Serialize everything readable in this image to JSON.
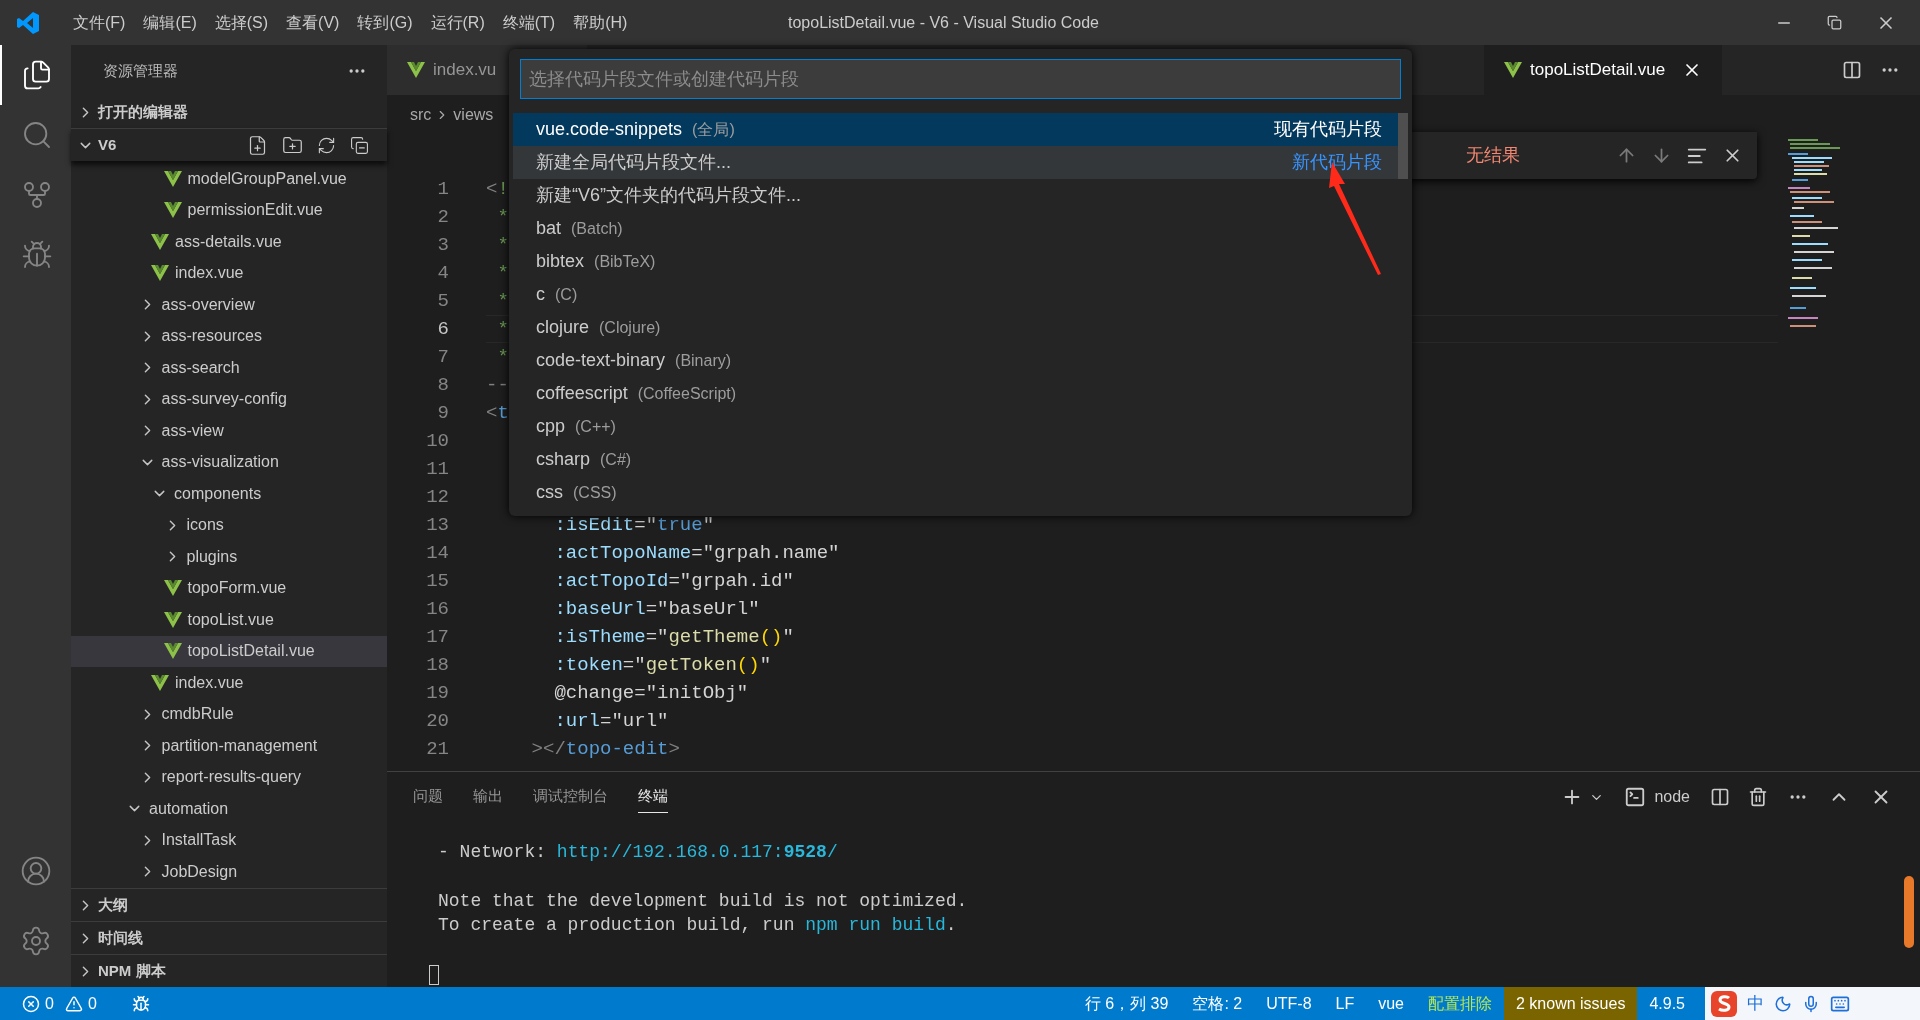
{
  "title_bar": {
    "menus": [
      "文件(F)",
      "编辑(E)",
      "选择(S)",
      "查看(V)",
      "转到(G)",
      "运行(R)",
      "终端(T)",
      "帮助(H)"
    ],
    "title": "topoListDetail.vue - V6 - Visual Studio Code"
  },
  "activity_bar": [
    {
      "kind": "files",
      "selected": true
    },
    {
      "kind": "search",
      "selected": false
    },
    {
      "kind": "scm",
      "selected": false
    },
    {
      "kind": "debug",
      "selected": false
    }
  ],
  "sidebar": {
    "title": "资源管理器",
    "open_editors": {
      "label": "打开的编辑器",
      "expanded": false
    },
    "folder": {
      "label": "V6",
      "expanded": true,
      "tree": [
        {
          "children": [
            {
              "children": [
                {
                  "children": [
                    {
                      "label": "modelGroupPanel.vue",
                      "kind": "file",
                      "selected": false
                    },
                    {
                      "label": "permissionEdit.vue",
                      "kind": "file",
                      "selected": false
                    }
                  ]
                },
                {
                  "label": "ass-details.vue",
                  "kind": "file",
                  "selected": false
                },
                {
                  "label": "index.vue",
                  "kind": "file",
                  "selected": false
                }
              ]
            },
            {
              "label": "ass-overview",
              "kind": "folder",
              "expanded": false,
              "selected": false
            },
            {
              "label": "ass-resources",
              "kind": "folder",
              "expanded": false,
              "selected": false
            },
            {
              "label": "ass-search",
              "kind": "folder",
              "expanded": false,
              "selected": false
            },
            {
              "label": "ass-survey-config",
              "kind": "folder",
              "expanded": false,
              "selected": false
            },
            {
              "label": "ass-view",
              "kind": "folder",
              "expanded": false,
              "selected": false
            },
            {
              "label": "ass-visualization",
              "kind": "folder",
              "expanded": true,
              "selected": false,
              "children": [
                {
                  "label": "components",
                  "kind": "folder",
                  "expanded": true,
                  "selected": false,
                  "children": [
                    {
                      "label": "icons",
                      "kind": "folder",
                      "expanded": false,
                      "selected": false
                    },
                    {
                      "label": "plugins",
                      "kind": "folder",
                      "expanded": false,
                      "selected": false
                    },
                    {
                      "label": "topoForm.vue",
                      "kind": "file",
                      "selected": false
                    },
                    {
                      "label": "topoList.vue",
                      "kind": "file",
                      "selected": false
                    },
                    {
                      "label": "topoListDetail.vue",
                      "kind": "file",
                      "selected": true
                    }
                  ]
                },
                {
                  "label": "index.vue",
                  "kind": "file",
                  "selected": false
                }
              ]
            },
            {
              "label": "cmdbRule",
              "kind": "folder",
              "expanded": false,
              "selected": false
            },
            {
              "label": "partition-management",
              "kind": "folder",
              "expanded": false,
              "selected": false
            },
            {
              "label": "report-results-query",
              "kind": "folder",
              "expanded": false,
              "selected": false
            }
          ]
        },
        {
          "label": "automation",
          "kind": "folder",
          "expanded": true,
          "selected": false,
          "children": [
            {
              "label": "InstallTask",
              "kind": "folder",
              "expanded": false,
              "selected": false
            },
            {
              "label": "JobDesign",
              "kind": "folder",
              "expanded": false,
              "selected": false
            }
          ]
        }
      ]
    },
    "sections": [
      {
        "label": "大纲",
        "expanded": false
      },
      {
        "label": "时间线",
        "expanded": false
      },
      {
        "label": "NPM 脚本",
        "expanded": false
      }
    ]
  },
  "editor": {
    "tabs": [
      {
        "label": "index.vu",
        "selected": false
      },
      {
        "label": "topoListDetail.vue",
        "selected": true
      }
    ],
    "breadcrumb": [
      "src",
      "views"
    ],
    "lines": [
      {
        "number": "1",
        "current": false,
        "tokens": [
          {
            "text": "<",
            "kind": "tag"
          },
          {
            "text": "!",
            "kind": "comment"
          }
        ]
      },
      {
        "number": "2",
        "current": false,
        "tokens": [
          {
            "text": " *",
            "kind": "comment"
          }
        ]
      },
      {
        "number": "3",
        "current": false,
        "tokens": [
          {
            "text": " *",
            "kind": "comment"
          }
        ]
      },
      {
        "number": "4",
        "current": false,
        "tokens": [
          {
            "text": " *",
            "kind": "comment"
          }
        ]
      },
      {
        "number": "5",
        "current": false,
        "tokens": [
          {
            "text": " *",
            "kind": "comment"
          }
        ]
      },
      {
        "number": "6",
        "current": true,
        "tokens": [
          {
            "text": " *",
            "kind": "comment"
          }
        ]
      },
      {
        "number": "7",
        "current": false,
        "tokens": [
          {
            "text": " *",
            "kind": "comment"
          }
        ]
      },
      {
        "number": "8",
        "current": false,
        "tokens": [
          {
            "text": "--",
            "kind": "tag"
          }
        ]
      },
      {
        "number": "9",
        "current": false,
        "tokens": [
          {
            "text": "<",
            "kind": "tag"
          },
          {
            "text": "t",
            "kind": "tagname"
          }
        ]
      },
      {
        "number": "10",
        "current": false
      },
      {
        "number": "11",
        "current": false
      },
      {
        "number": "12",
        "current": false
      },
      {
        "number": "13",
        "current": false,
        "tokens": [
          {
            "text": "      :isEdit",
            "kind": "attr"
          },
          {
            "text": "=\"",
            "kind": "text"
          },
          {
            "text": "true",
            "kind": "keyword"
          },
          {
            "text": "\"",
            "kind": "text"
          }
        ]
      },
      {
        "number": "14",
        "current": false,
        "tokens": [
          {
            "text": "      :actTopoName",
            "kind": "attr"
          },
          {
            "text": "=\"grpah.name\"",
            "kind": "text"
          }
        ]
      },
      {
        "number": "15",
        "current": false,
        "tokens": [
          {
            "text": "      :actTopoId",
            "kind": "attr"
          },
          {
            "text": "=\"grpah.id\"",
            "kind": "text"
          }
        ]
      },
      {
        "number": "16",
        "current": false,
        "tokens": [
          {
            "text": "      :baseUrl",
            "kind": "attr"
          },
          {
            "text": "=\"baseUrl\"",
            "kind": "text"
          }
        ]
      },
      {
        "number": "17",
        "current": false,
        "tokens": [
          {
            "text": "      :isTheme",
            "kind": "attr"
          },
          {
            "text": "=\"",
            "kind": "text"
          },
          {
            "text": "getTheme",
            "kind": "fn"
          },
          {
            "text": "()",
            "kind": "paren"
          },
          {
            "text": "\"",
            "kind": "text"
          }
        ]
      },
      {
        "number": "18",
        "current": false,
        "tokens": [
          {
            "text": "      :token",
            "kind": "attr"
          },
          {
            "text": "=\"",
            "kind": "text"
          },
          {
            "text": "getToken",
            "kind": "fn"
          },
          {
            "text": "()",
            "kind": "paren"
          },
          {
            "text": "\"",
            "kind": "text"
          }
        ]
      },
      {
        "number": "19",
        "current": false,
        "tokens": [
          {
            "text": "      @change=\"initObj\"",
            "kind": "text"
          }
        ]
      },
      {
        "number": "20",
        "current": false,
        "tokens": [
          {
            "text": "      :url",
            "kind": "attr"
          },
          {
            "text": "=\"url\"",
            "kind": "text"
          }
        ]
      },
      {
        "number": "21",
        "current": false,
        "tokens": [
          {
            "text": "    ></",
            "kind": "tag"
          },
          {
            "text": "topo-edit",
            "kind": "tagname"
          },
          {
            "text": ">",
            "kind": "tag"
          }
        ]
      }
    ],
    "find_widget": {
      "message": "无结果"
    }
  },
  "quick_pick": {
    "placeholder": "选择代码片段文件或创建代码片段",
    "items": [
      {
        "label": "vue.code-snippets",
        "description": "(全局)",
        "group_label": "现有代码片段",
        "selected": true,
        "hovered": false
      },
      {
        "label": "新建全局代码片段文件...",
        "group_label": "新代码片段",
        "selected": false,
        "hovered": true
      },
      {
        "label": "新建“V6”文件夹的代码片段文件...",
        "selected": false,
        "hovered": false
      },
      {
        "label": "bat",
        "description": "(Batch)",
        "selected": false,
        "hovered": false
      },
      {
        "label": "bibtex",
        "description": "(BibTeX)",
        "selected": false,
        "hovered": false
      },
      {
        "label": "c",
        "description": "(C)",
        "selected": false,
        "hovered": false
      },
      {
        "label": "clojure",
        "description": "(Clojure)",
        "selected": false,
        "hovered": false
      },
      {
        "label": "code-text-binary",
        "description": "(Binary)",
        "selected": false,
        "hovered": false
      },
      {
        "label": "coffeescript",
        "description": "(CoffeeScript)",
        "selected": false,
        "hovered": false
      },
      {
        "label": "cpp",
        "description": "(C++)",
        "selected": false,
        "hovered": false
      },
      {
        "label": "csharp",
        "description": "(C#)",
        "selected": false,
        "hovered": false
      },
      {
        "label": "css",
        "description": "(CSS)",
        "selected": false,
        "hovered": false
      }
    ]
  },
  "panel": {
    "tabs": [
      {
        "label": "问题",
        "selected": false
      },
      {
        "label": "输出",
        "selected": false
      },
      {
        "label": "调试控制台",
        "selected": false
      },
      {
        "label": "终端",
        "selected": true
      }
    ],
    "terminal_name": "node",
    "terminal": [
      {
        "kind": "output",
        "tokens": [
          {
            "text": "- Network: ",
            "kind": "text"
          },
          {
            "text": "http://192.168.0.117:",
            "kind": "link"
          },
          {
            "text": "9528",
            "kind": "link_bold"
          },
          {
            "text": "/",
            "kind": "link"
          }
        ]
      },
      {
        "kind": "blank"
      },
      {
        "kind": "output",
        "tokens": [
          {
            "text": "Note that the development build is not optimized.",
            "kind": "text"
          }
        ]
      },
      {
        "kind": "output",
        "tokens": [
          {
            "text": "To create a production build, run ",
            "kind": "text"
          },
          {
            "text": "npm run build",
            "kind": "link"
          },
          {
            "text": ".",
            "kind": "text"
          }
        ]
      },
      {
        "kind": "blank"
      },
      {
        "kind": "cursor"
      }
    ]
  },
  "status_bar": {
    "errors": "0",
    "warnings": "0",
    "items": [
      {
        "label": "行 6，列 39",
        "kind": "plain"
      },
      {
        "label": "空格: 2",
        "kind": "plain"
      },
      {
        "label": "UTF-8",
        "kind": "plain"
      },
      {
        "label": "LF",
        "kind": "plain"
      },
      {
        "label": "vue",
        "kind": "plain"
      },
      {
        "label": "配置排除",
        "kind": "highlight"
      },
      {
        "label": "2 known issues",
        "kind": "warning"
      },
      {
        "label": "4.9.5",
        "kind": "plain"
      }
    ]
  },
  "ime": {
    "mode": "中"
  }
}
